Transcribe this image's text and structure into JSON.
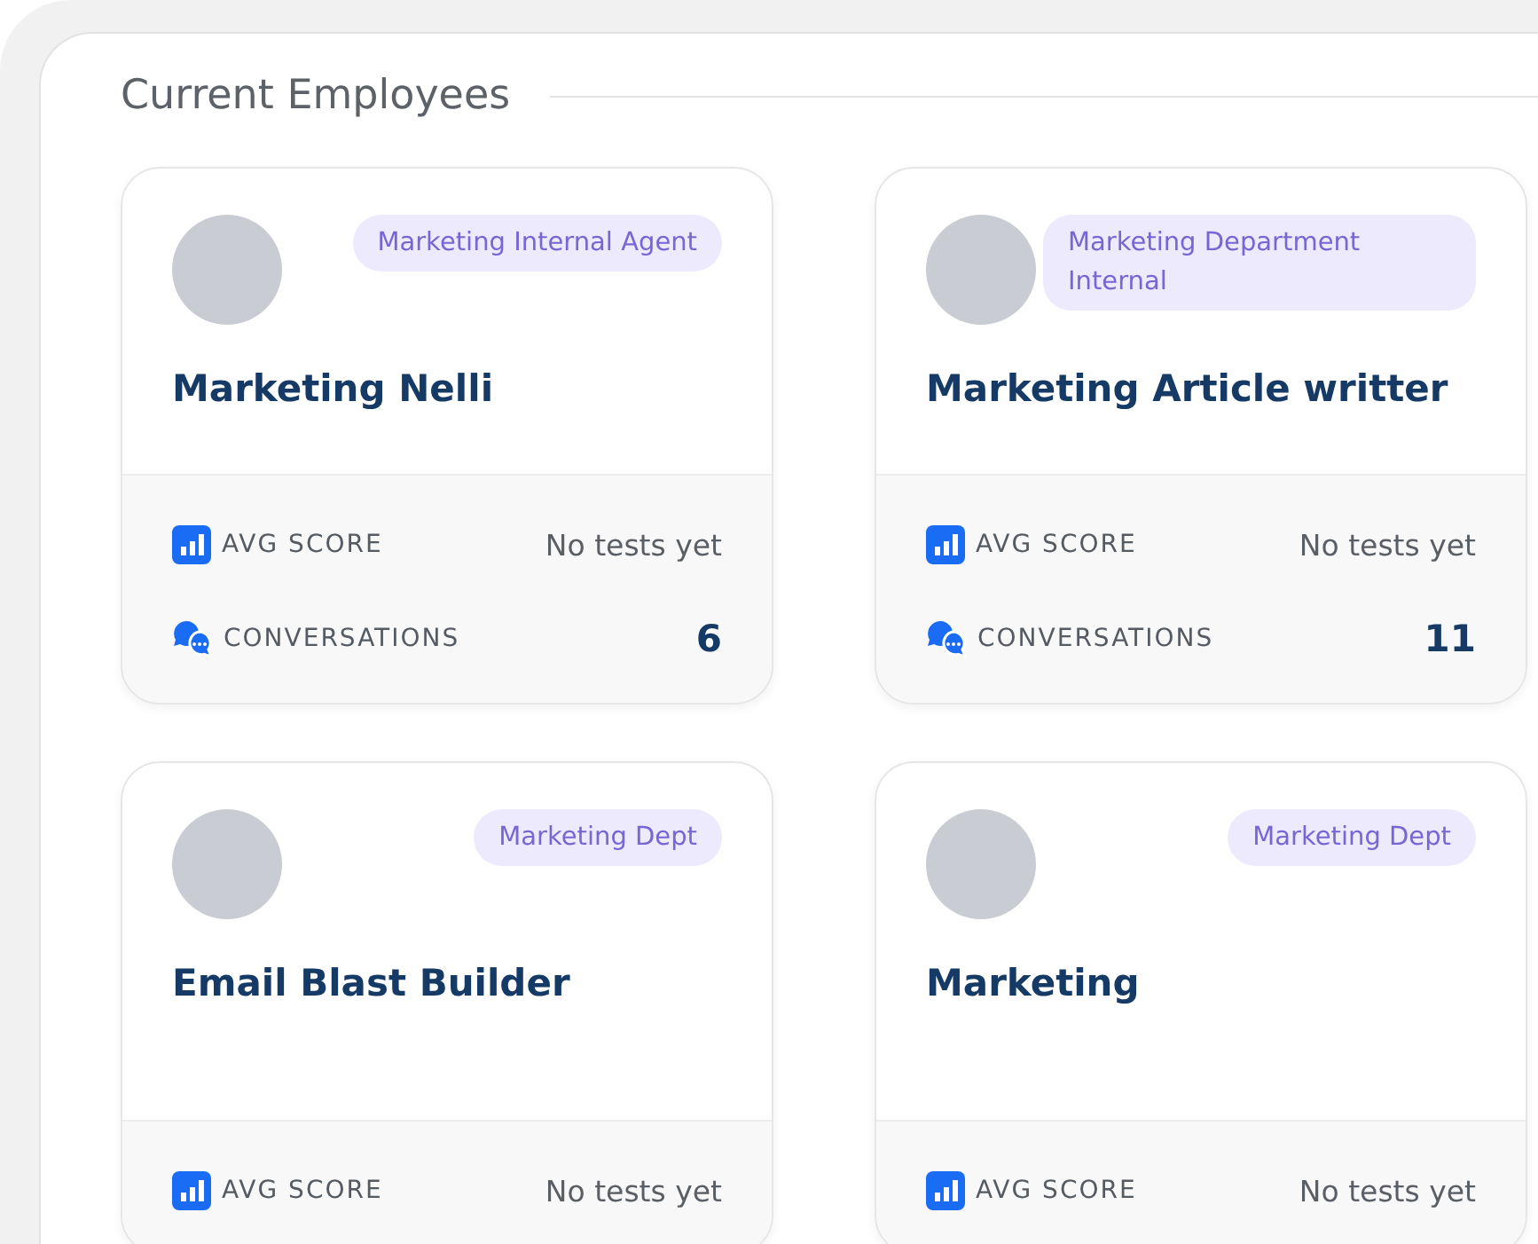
{
  "section": {
    "title": "Current Employees"
  },
  "employees": [
    {
      "name": "Marketing Nelli",
      "tag": "Marketing Internal Agent",
      "stats": [
        {
          "kind": "score",
          "label": "AVG SCORE",
          "value": "No tests yet"
        },
        {
          "kind": "conversations",
          "label": "CONVERSATIONS",
          "value": "6"
        }
      ]
    },
    {
      "name": "Marketing Article writter",
      "tag": "Marketing Department Internal",
      "stats": [
        {
          "kind": "score",
          "label": "AVG SCORE",
          "value": "No tests yet"
        },
        {
          "kind": "conversations",
          "label": "CONVERSATIONS",
          "value": "11"
        }
      ]
    },
    {
      "name": "Email Blast Builder",
      "tag": "Marketing Dept",
      "stats": [
        {
          "kind": "score",
          "label": "AVG SCORE",
          "value": "No tests yet"
        }
      ]
    },
    {
      "name": "Marketing",
      "tag": "Marketing Dept",
      "stats": [
        {
          "kind": "score",
          "label": "AVG SCORE",
          "value": "No tests yet"
        }
      ]
    }
  ]
}
